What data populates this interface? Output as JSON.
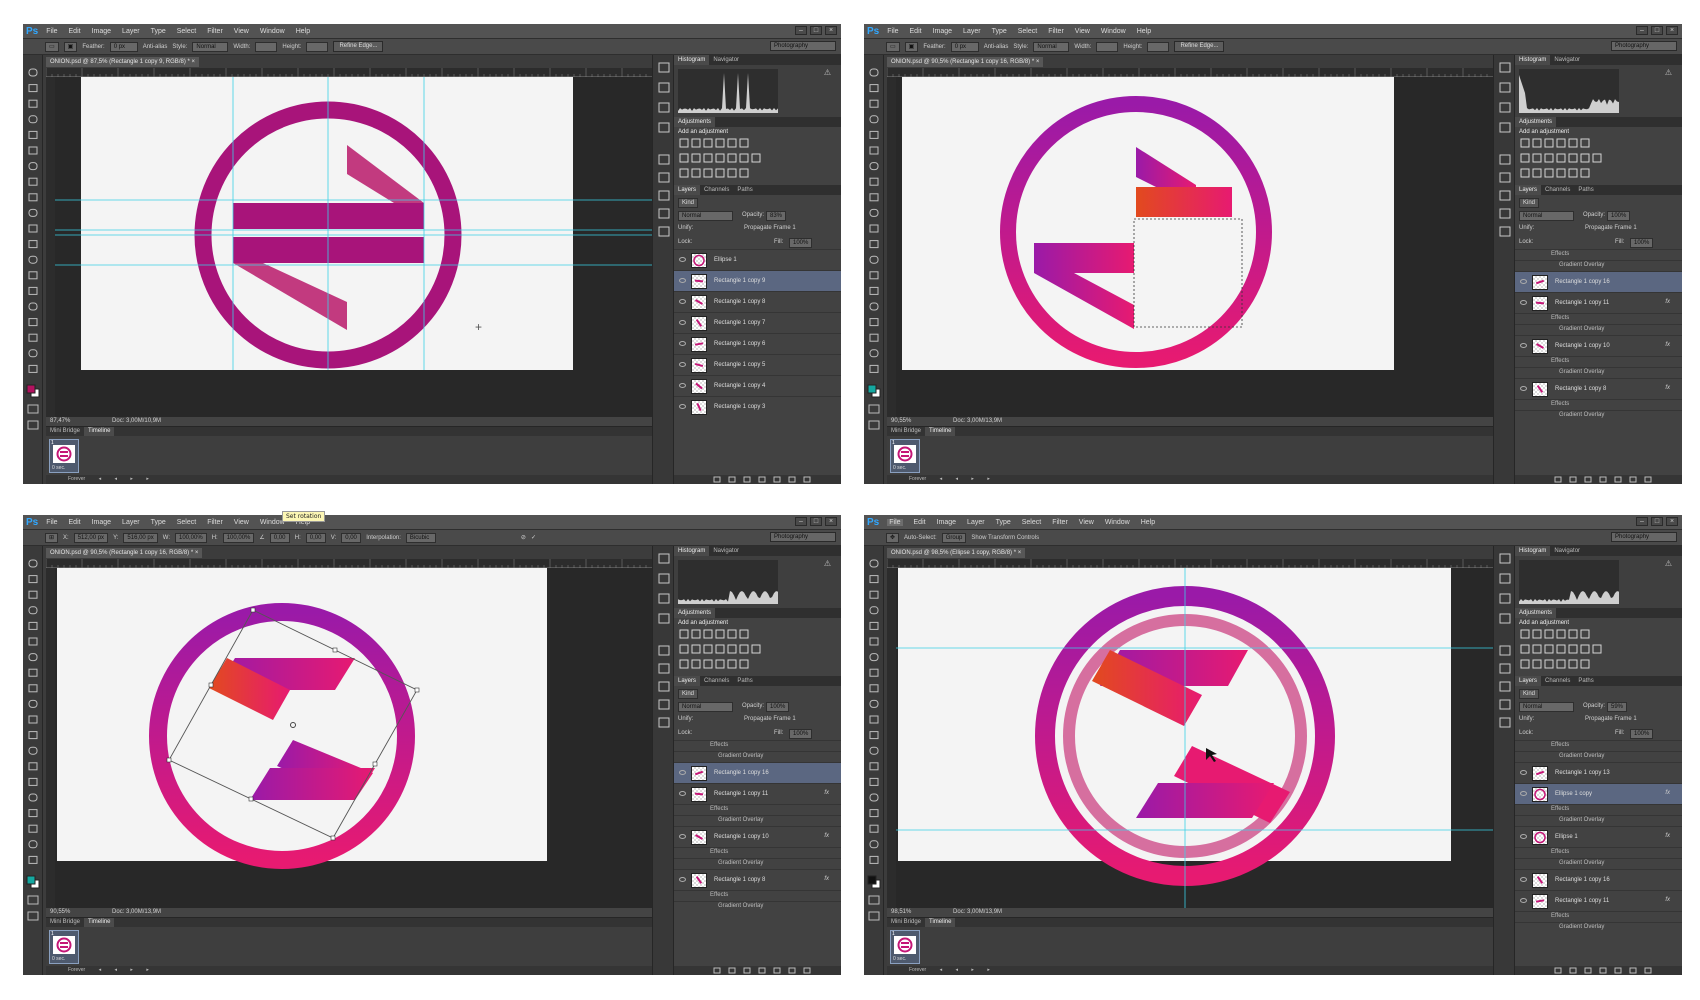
{
  "menu": [
    "File",
    "Edit",
    "Image",
    "Layer",
    "Type",
    "Select",
    "Filter",
    "View",
    "Window",
    "Help"
  ],
  "window_controls": [
    "–",
    "□",
    "×"
  ],
  "workspace": "Photography",
  "colors": {
    "gradient_a": "#9a1aa8",
    "gradient_b": "#e71a71",
    "orange": "#e24a1e",
    "magenta": "#a8147a",
    "guide": "#3ad0e6",
    "accent_fg": "#b3125f",
    "accent_bg": "#14a8a0"
  },
  "panels": {
    "histogram_tab": "Histogram",
    "navigator_tab": "Navigator",
    "adjustments_tab": "Adjustments",
    "add_adjustment": "Add an adjustment",
    "layers_tab": "Layers",
    "channels_tab": "Channels",
    "paths_tab": "Paths",
    "kind": "Kind",
    "blend": "Normal",
    "opacity_label": "Opacity:",
    "unify": "Unify:",
    "propagate": "Propagate Frame 1",
    "lock": "Lock:",
    "fill_label": "Fill:",
    "effects": "Effects",
    "gradient_overlay": "Gradient Overlay"
  },
  "timeline": {
    "mini_bridge": "Mini Bridge",
    "timeline": "Timeline",
    "frame_num": "1",
    "frame_time": "0 sec.",
    "loop": "Forever"
  },
  "panes": [
    {
      "doc_tab": "ONION.psd @ 87,5% (Rectangle 1 copy 9, RGB/8) * ×",
      "zoom": "87,47%",
      "doc": "Doc: 3,00M/10,9M",
      "options": {
        "feather_label": "Feather:",
        "feather": "0 px",
        "antialias": "Anti-alias",
        "style_label": "Style:",
        "style": "Normal",
        "width_label": "Width:",
        "height_label": "Height:",
        "refine": "Refine Edge..."
      },
      "opacity": "83%",
      "fill": "100%",
      "layers": [
        {
          "name": "Ellipse 1",
          "sel": false,
          "fx": false
        },
        {
          "name": "Rectangle 1 copy 9",
          "sel": true,
          "fx": false
        },
        {
          "name": "Rectangle 1 copy 8",
          "sel": false,
          "fx": false
        },
        {
          "name": "Rectangle 1 copy 7",
          "sel": false,
          "fx": false
        },
        {
          "name": "Rectangle 1 copy 6",
          "sel": false,
          "fx": false
        },
        {
          "name": "Rectangle 1 copy 5",
          "sel": false,
          "fx": false
        },
        {
          "name": "Rectangle 1 copy 4",
          "sel": false,
          "fx": false
        },
        {
          "name": "Rectangle 1 copy 3",
          "sel": false,
          "fx": false
        }
      ]
    },
    {
      "doc_tab": "ONION.psd @ 90,5% (Rectangle 1 copy 16, RGB/8) * ×",
      "zoom": "90,55%",
      "doc": "Doc: 3,00M/13,9M",
      "options": {
        "feather_label": "Feather:",
        "feather": "0 px",
        "antialias": "Anti-alias",
        "style_label": "Style:",
        "style": "Normal",
        "width_label": "Width:",
        "height_label": "Height:",
        "refine": "Refine Edge..."
      },
      "opacity": "100%",
      "fill": "100%",
      "layers": [
        {
          "name": "Rectangle 1 copy 16",
          "sel": true,
          "fx": false
        },
        {
          "name": "Rectangle 1 copy 11",
          "sel": false,
          "fx": true
        },
        {
          "name": "Rectangle 1 copy 10",
          "sel": false,
          "fx": true
        },
        {
          "name": "Rectangle 1 copy 8",
          "sel": false,
          "fx": true
        }
      ]
    },
    {
      "doc_tab": "ONION.psd @ 90,5% (Rectangle 1 copy 16, RGB/8) * ×",
      "zoom": "90,55%",
      "doc": "Doc: 3,00M/13,9M",
      "options": {
        "x_label": "X:",
        "x": "512,00 px",
        "y_label": "Y:",
        "y": "516,00 px",
        "w_label": "W:",
        "w": "100,00%",
        "h_label": "H:",
        "h": "100,00%",
        "angle": "0,00",
        "hskew_label": "H:",
        "hskew": "0,00",
        "vskew_label": "V:",
        "vskew": "0,00",
        "interp_label": "Interpolation:",
        "interp": "Bicubic"
      },
      "tooltip": "Set rotation",
      "opacity": "100%",
      "fill": "100%",
      "layers": [
        {
          "name": "Rectangle 1 copy 16",
          "sel": true,
          "fx": false
        },
        {
          "name": "Rectangle 1 copy 11",
          "sel": false,
          "fx": true
        },
        {
          "name": "Rectangle 1 copy 10",
          "sel": false,
          "fx": true
        },
        {
          "name": "Rectangle 1 copy 8",
          "sel": false,
          "fx": true
        }
      ]
    },
    {
      "doc_tab": "ONION.psd @ 98,5% (Ellipse 1 copy, RGB/8) * ×",
      "zoom": "98,51%",
      "doc": "Doc: 3,00M/13,9M",
      "options": {
        "autoselect": "Auto-Select:",
        "group": "Group",
        "transform": "Show Transform Controls"
      },
      "opacity": "59%",
      "fill": "100%",
      "layers": [
        {
          "name": "Rectangle 1 copy 13",
          "sel": false,
          "fx": false
        },
        {
          "name": "Ellipse 1 copy",
          "sel": true,
          "fx": true
        },
        {
          "name": "Ellipse 1",
          "sel": false,
          "fx": true
        },
        {
          "name": "Rectangle 1 copy 16",
          "sel": false,
          "fx": false
        },
        {
          "name": "Rectangle 1 copy 11",
          "sel": false,
          "fx": true
        }
      ]
    }
  ]
}
